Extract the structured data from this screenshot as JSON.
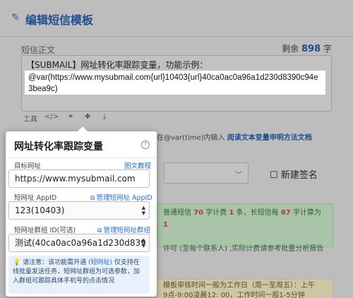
{
  "header": {
    "title": "编辑短信模板"
  },
  "sms_body": {
    "label": "短信正文",
    "remaining_prefix": "剩余",
    "remaining_count": "898",
    "remaining_suffix": "字",
    "line1": "【SUBMAIL】网址转化率跟踪变量，功能示例：",
    "highlighted": "@var(https://www.mysubmail.com{url}10403{url}40ca0ac0a96a1d230d8390c94e3bea9c)"
  },
  "toolbar": {
    "items": [
      "工具",
      "</>",
      "⚭",
      "✚",
      "⤓"
    ]
  },
  "var_tip": {
    "text": "在@var(time)内输入",
    "link": "阅读文本变量申明方法文档"
  },
  "new_signature": {
    "label": "新建签名"
  },
  "green_notice": {
    "line1_a": "普通短信",
    "line1_n1": "70",
    "line1_b": "字计费",
    "line1_n2": "1",
    "line1_c": "条，长短信每",
    "line1_n3": "67",
    "line1_d": "字计算为",
    "line1_n4": "1",
    "line2": "许可 (至每个联系人) ,实际计费请参考批量分析报告"
  },
  "yellow_notice": {
    "line1": "模板审核时间一般为工作日（周一至周五）：上午",
    "line2": "9点-9:00凌晨12: 00，工作时间一般1-5分钟"
  },
  "popover": {
    "title": "网址转化率跟踪变量",
    "target_url": {
      "label": "目标网址",
      "link": "图文教程",
      "value": "https://www.mysubmail.com"
    },
    "app_id": {
      "label": "短网址 AppID",
      "link": "管理短网址 AppID",
      "value": "123(10403)"
    },
    "group_id": {
      "label": "短网址群组 ID(可选)",
      "link": "管理短网址群组",
      "value": "测试(40ca0ac0a96a1d230d839"
    },
    "notice": {
      "prefix": "请注意：该功能需开通",
      "link": "(短网址)",
      "rest": "仅支持在线批量发送任务，短网址群组为可选参数，加入群组可跟踪具体手机号的点击情况"
    }
  }
}
